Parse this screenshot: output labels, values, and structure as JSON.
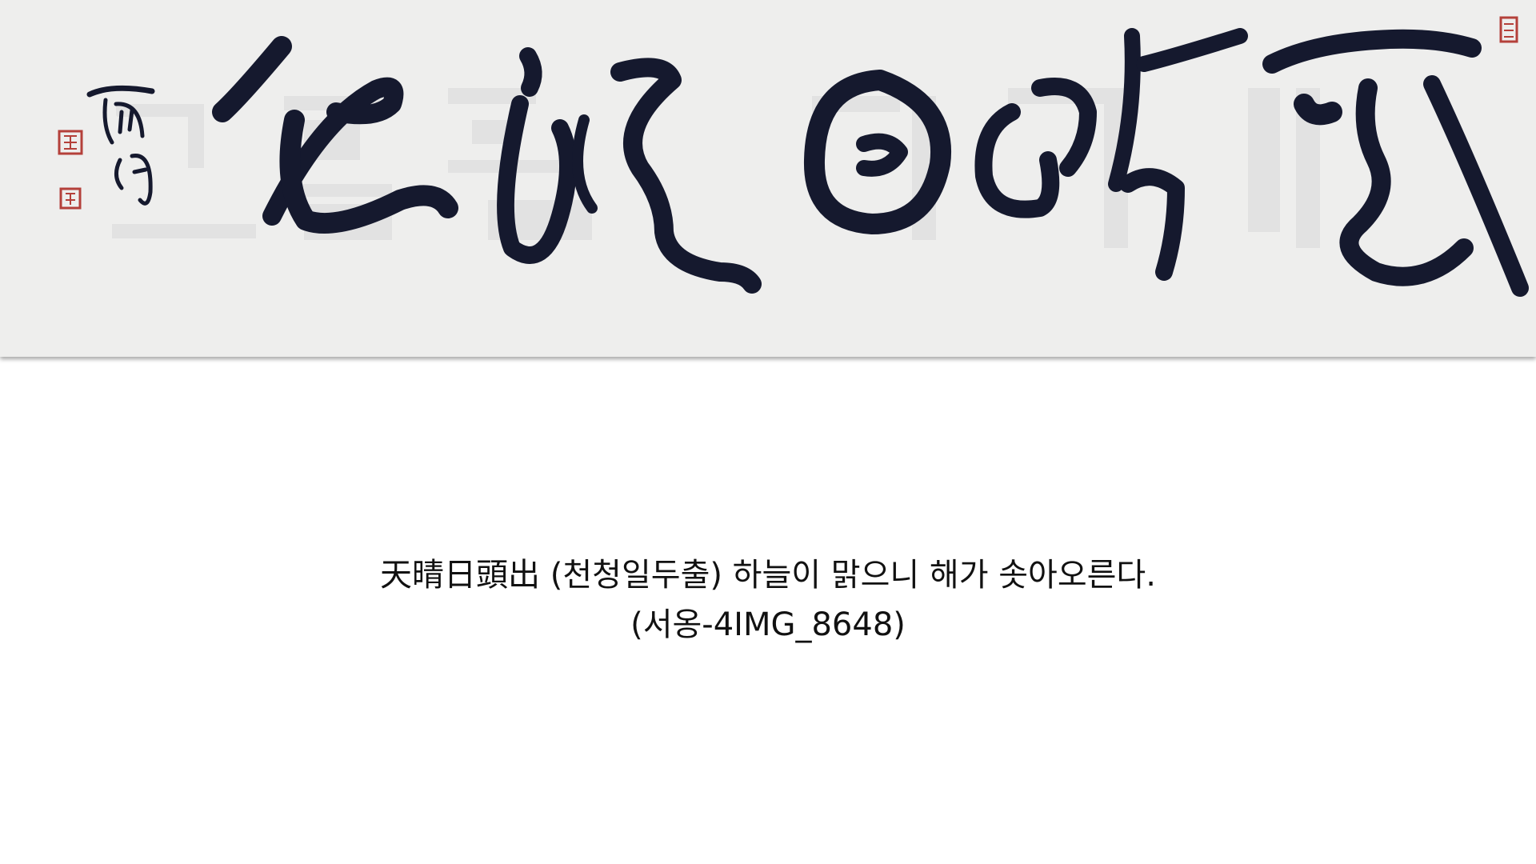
{
  "artwork": {
    "calligraphy_characters": [
      "天",
      "晴",
      "日",
      "頭",
      "出"
    ],
    "signature": "西翁",
    "watermark": "도솔산 한약사",
    "ink_color": "#15192e",
    "paper_color": "#eeeeed",
    "seal_color": "#b4403a"
  },
  "caption": {
    "line1": "天晴日頭出 (천청일두출) 하늘이 맑으니 해가 솟아오른다.",
    "line2": "(서옹-4IMG_8648)"
  }
}
